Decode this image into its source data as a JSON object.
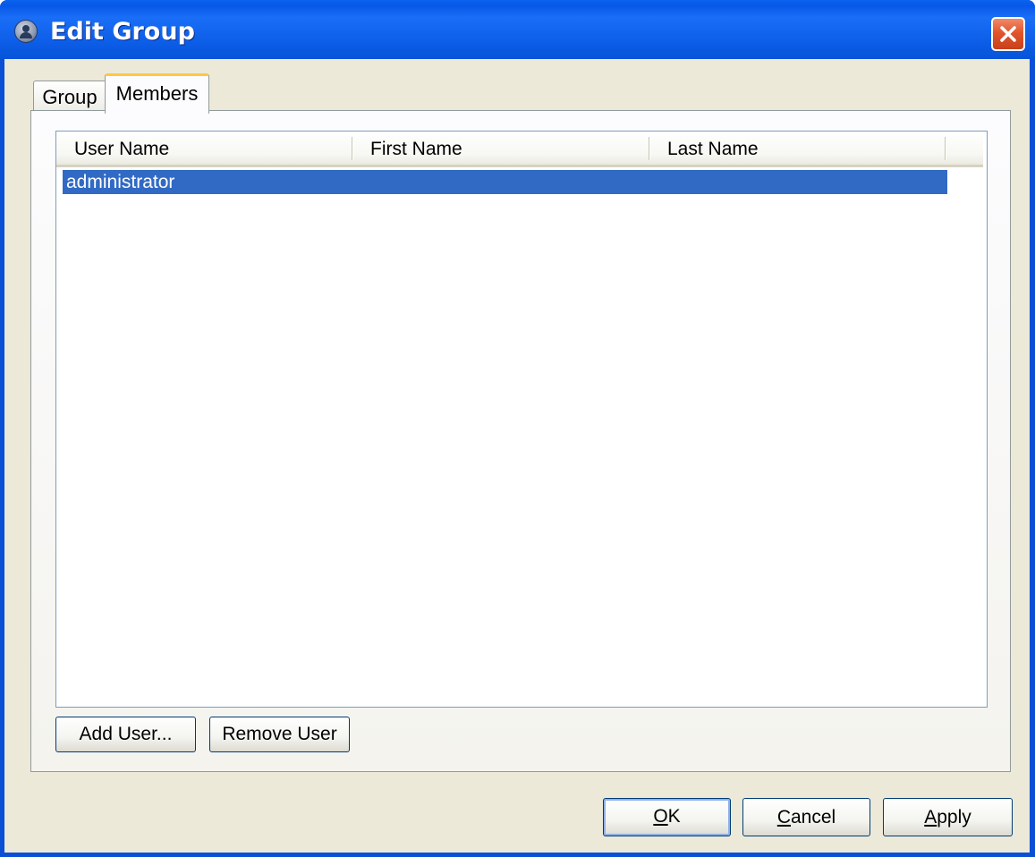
{
  "window": {
    "title": "Edit Group"
  },
  "tabs": [
    {
      "label": "Group",
      "active": false
    },
    {
      "label": "Members",
      "active": true
    }
  ],
  "members_list": {
    "columns": [
      "User Name",
      "First Name",
      "Last Name"
    ],
    "rows": [
      {
        "user_name": "administrator",
        "first_name": "",
        "last_name": "",
        "selected": true
      }
    ]
  },
  "list_buttons": {
    "add": "Add User...",
    "remove": "Remove User"
  },
  "dialog_buttons": {
    "ok_mnemonic": "O",
    "ok_rest": "K",
    "cancel_mnemonic": "C",
    "cancel_rest": "ancel",
    "apply_mnemonic": "A",
    "apply_rest": "pply"
  },
  "colors": {
    "titlebar": "#0a5ee8",
    "selection": "#316ac5",
    "close_button": "#e2562c",
    "tab_highlight": "#ffc83c"
  }
}
